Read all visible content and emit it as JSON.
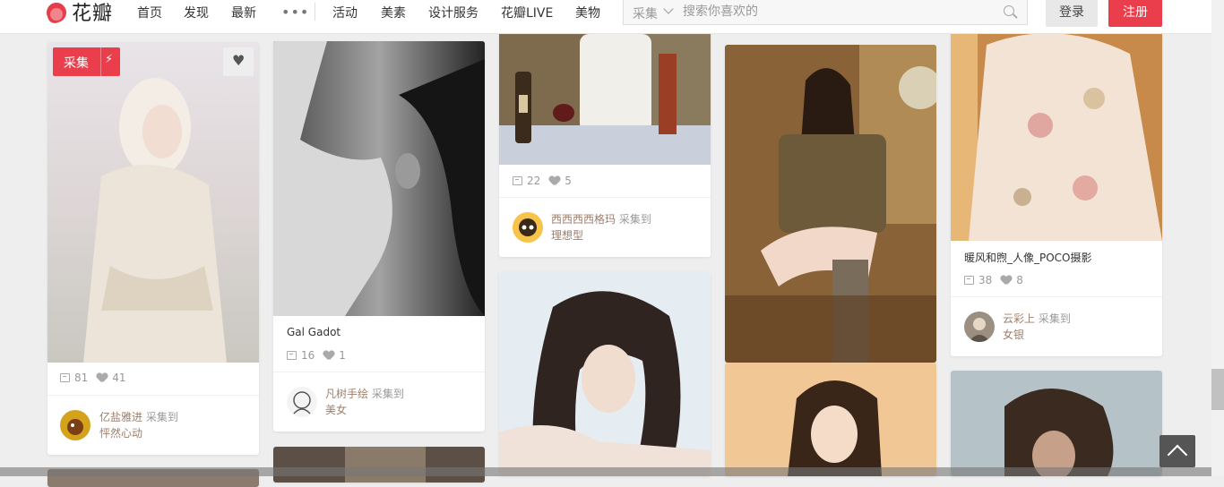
{
  "header": {
    "logo_text": "花瓣",
    "nav": [
      "首页",
      "发现",
      "最新"
    ],
    "more": "•••",
    "nav2": [
      "活动",
      "美素",
      "设计服务",
      "花瓣LIVE",
      "美物"
    ],
    "search_scope": "采集",
    "search_placeholder": "搜索你喜欢的",
    "login": "登录",
    "register": "注册"
  },
  "pins": [
    {
      "badge": "采集",
      "title": "",
      "repins": "81",
      "likes": "41",
      "user": "亿盐雅进",
      "action": "采集到",
      "board": "怦然心动"
    },
    {
      "title": "Gal Gadot",
      "repins": "16",
      "likes": "1",
      "user": "凡树手绘",
      "action": "采集到",
      "board": "美女"
    },
    {
      "title": "",
      "repins": "22",
      "likes": "5",
      "user": "西西西西格玛",
      "action": "采集到",
      "board": "理想型"
    },
    {
      "title": "暖风和煦_人像_POCO摄影",
      "repins": "38",
      "likes": "8",
      "user": "云彩上",
      "action": "采集到",
      "board": "女银"
    }
  ],
  "colors": {
    "brand": "#ea3e4d",
    "username": "#9e7e6b"
  }
}
